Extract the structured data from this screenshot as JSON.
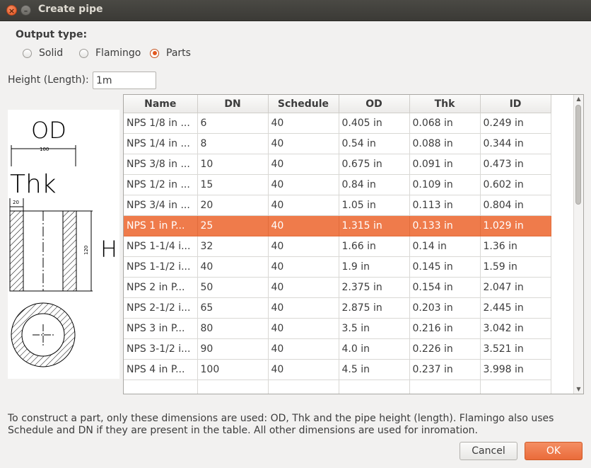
{
  "window": {
    "title": "Create pipe"
  },
  "output_type": {
    "label": "Output type:",
    "options": [
      {
        "label": "Solid",
        "selected": false
      },
      {
        "label": "Flamingo",
        "selected": false
      },
      {
        "label": "Parts",
        "selected": true
      }
    ]
  },
  "height": {
    "label": "Height (Length):",
    "value": "1m"
  },
  "drawing": {
    "od_label": "OD",
    "thk_label": "Thk",
    "h_label": "H",
    "dim_100": "100",
    "dim_20": "20",
    "dim_120": "120"
  },
  "table": {
    "columns": [
      "Name",
      "DN",
      "Schedule",
      "OD",
      "Thk",
      "ID"
    ],
    "selected_row": 5,
    "rows": [
      [
        "NPS 1/8 in ...",
        "6",
        "40",
        "0.405 in",
        "0.068 in",
        "0.249 in"
      ],
      [
        "NPS 1/4 in ...",
        "8",
        "40",
        "0.54 in",
        "0.088 in",
        "0.344 in"
      ],
      [
        "NPS 3/8 in ...",
        "10",
        "40",
        "0.675 in",
        "0.091 in",
        "0.473 in"
      ],
      [
        "NPS 1/2 in ...",
        "15",
        "40",
        "0.84 in",
        "0.109 in",
        "0.602 in"
      ],
      [
        "NPS 3/4 in ...",
        "20",
        "40",
        "1.05 in",
        "0.113 in",
        "0.804 in"
      ],
      [
        "NPS 1 in P...",
        "25",
        "40",
        "1.315 in",
        "0.133 in",
        "1.029 in"
      ],
      [
        "NPS 1-1/4 i...",
        "32",
        "40",
        "1.66 in",
        "0.14 in",
        "1.36 in"
      ],
      [
        "NPS 1-1/2 i...",
        "40",
        "40",
        "1.9 in",
        "0.145 in",
        "1.59 in"
      ],
      [
        "NPS 2 in P...",
        "50",
        "40",
        "2.375 in",
        "0.154 in",
        "2.047 in"
      ],
      [
        "NPS 2-1/2 i...",
        "65",
        "40",
        "2.875 in",
        "0.203 in",
        "2.445 in"
      ],
      [
        "NPS 3 in P...",
        "80",
        "40",
        "3.5 in",
        "0.216 in",
        "3.042 in"
      ],
      [
        "NPS 3-1/2 i...",
        "90",
        "40",
        "4.0 in",
        "0.226 in",
        "3.521 in"
      ],
      [
        "NPS 4 in P...",
        "100",
        "40",
        "4.5 in",
        "0.237 in",
        "3.998 in"
      ],
      [
        "",
        "",
        "",
        "",
        "",
        ""
      ]
    ]
  },
  "info_text": "To construct a part, only these dimensions are used: OD, Thk and the pipe height (length). Flamingo also uses Schedule and DN if they are present in the table. All other dimensions are used for inromation.",
  "buttons": {
    "cancel": "Cancel",
    "ok": "OK"
  },
  "colors": {
    "accent": "#ef7b4b",
    "titlebar": "#3b3a36"
  }
}
